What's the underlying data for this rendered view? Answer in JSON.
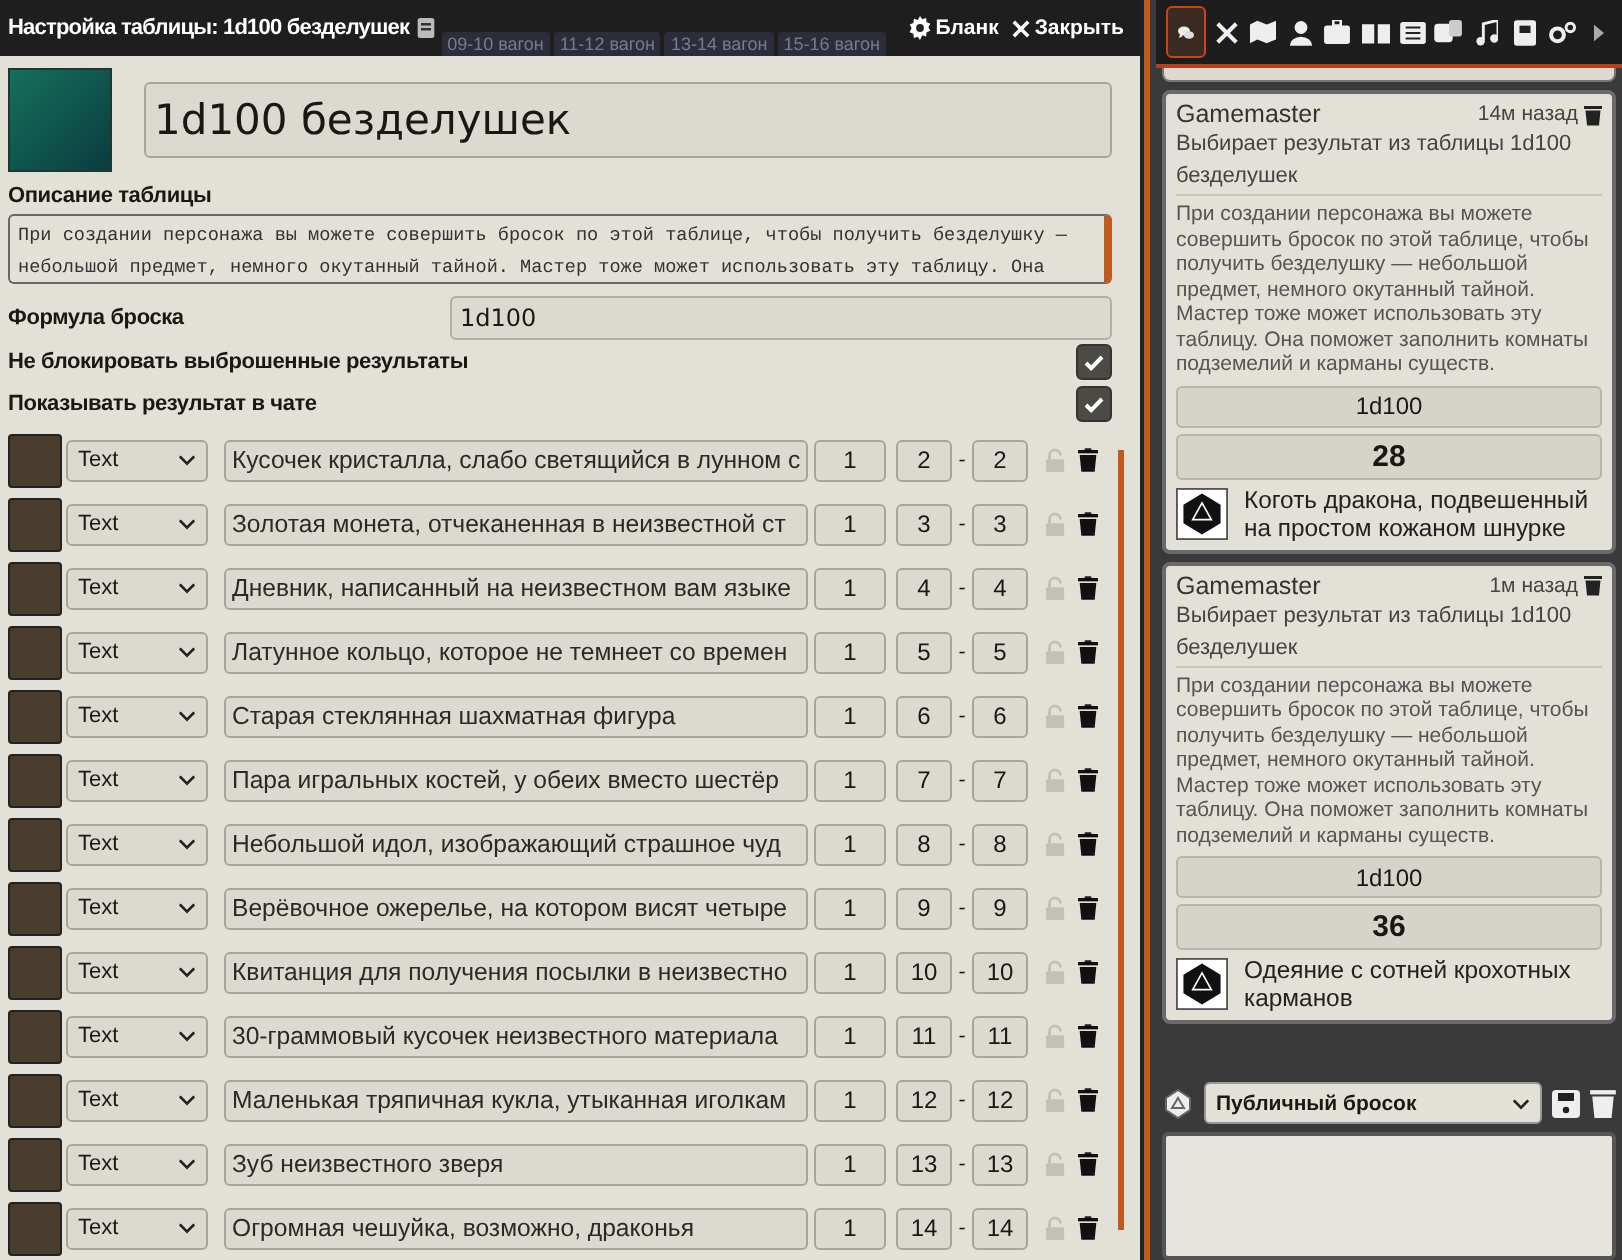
{
  "window": {
    "title": "Настройка таблицы: 1d100 безделушек",
    "buttons": [
      {
        "kind": "settings",
        "label": "Бланк"
      },
      {
        "kind": "close",
        "label": "Закрыть"
      }
    ]
  },
  "scene_tabs": [
    "09-10 вагон",
    "11-12 вагон",
    "13-14 вагон",
    "15-16 вагон"
  ],
  "table": {
    "name": "1d100 безделушек",
    "description_label": "Описание таблицы",
    "description": "При создании персонажа вы можете совершить бросок по этой таблице, чтобы получить безделушку — небольшой предмет, немного окутанный тайной. Мастер тоже может использовать эту таблицу. Она",
    "formula_label": "Формула броска",
    "formula": "1d100",
    "options": [
      {
        "label": "Не блокировать выброшенные результаты",
        "checked": true
      },
      {
        "label": "Показывать результат в чате",
        "checked": true
      }
    ],
    "results": [
      {
        "type": "Text",
        "text": "Кусочек кристалла, слабо светящийся в лунном с",
        "weight": "1",
        "range_low": "2",
        "dash": "-",
        "range_high": "2",
        "locked": false
      },
      {
        "type": "Text",
        "text": "Золотая монета, отчеканенная в неизвестной ст",
        "weight": "1",
        "range_low": "3",
        "dash": "-",
        "range_high": "3",
        "locked": false
      },
      {
        "type": "Text",
        "text": "Дневник, написанный на неизвестном вам языке",
        "weight": "1",
        "range_low": "4",
        "dash": "-",
        "range_high": "4",
        "locked": false
      },
      {
        "type": "Text",
        "text": "Латунное кольцо, которое не темнеет со времен",
        "weight": "1",
        "range_low": "5",
        "dash": "-",
        "range_high": "5",
        "locked": false
      },
      {
        "type": "Text",
        "text": "Старая стеклянная шахматная фигура",
        "weight": "1",
        "range_low": "6",
        "dash": "-",
        "range_high": "6",
        "locked": false
      },
      {
        "type": "Text",
        "text": "Пара игральных костей, у обеих вместо шестёр",
        "weight": "1",
        "range_low": "7",
        "dash": "-",
        "range_high": "7",
        "locked": false
      },
      {
        "type": "Text",
        "text": "Небольшой идол, изображающий страшное чуд",
        "weight": "1",
        "range_low": "8",
        "dash": "-",
        "range_high": "8",
        "locked": false
      },
      {
        "type": "Text",
        "text": "Верёвочное ожерелье, на котором висят четыре",
        "weight": "1",
        "range_low": "9",
        "dash": "-",
        "range_high": "9",
        "locked": false
      },
      {
        "type": "Text",
        "text": "Квитанция для получения посылки в неизвестно",
        "weight": "1",
        "range_low": "10",
        "dash": "-",
        "range_high": "10",
        "locked": false
      },
      {
        "type": "Text",
        "text": "30-граммовый кусочек неизвестного материала",
        "weight": "1",
        "range_low": "11",
        "dash": "-",
        "range_high": "11",
        "locked": false
      },
      {
        "type": "Text",
        "text": "Маленькая тряпичная кукла, утыканная иголкам",
        "weight": "1",
        "range_low": "12",
        "dash": "-",
        "range_high": "12",
        "locked": false
      },
      {
        "type": "Text",
        "text": "Зуб неизвестного зверя",
        "weight": "1",
        "range_low": "13",
        "dash": "-",
        "range_high": "13",
        "locked": false
      },
      {
        "type": "Text",
        "text": "Огромная чешуйка, возможно, драконья",
        "weight": "1",
        "range_low": "14",
        "dash": "-",
        "range_high": "14",
        "locked": false
      }
    ]
  },
  "sidebar": {
    "tabs": [
      {
        "kind": "chat",
        "selected": true
      },
      {
        "kind": "combat",
        "selected": false
      },
      {
        "kind": "scenes",
        "selected": false
      },
      {
        "kind": "actors",
        "selected": false
      },
      {
        "kind": "items",
        "selected": false
      },
      {
        "kind": "journal",
        "selected": false
      },
      {
        "kind": "tables",
        "selected": false
      },
      {
        "kind": "cards",
        "selected": false
      },
      {
        "kind": "playlists",
        "selected": false
      },
      {
        "kind": "compendium",
        "selected": false
      },
      {
        "kind": "settings",
        "selected": false
      },
      {
        "kind": "collapse",
        "selected": false
      }
    ],
    "messages": [
      {
        "author": "Gamemaster",
        "time": "14м назад",
        "flavor": "Выбирает результат из таблицы 1d100 безделушек",
        "description": "При создании персонажа вы можете совершить бросок по этой таблице, чтобы получить безделушку — небольшой предмет, немного окутанный тайной. Мастер тоже может использовать эту таблицу. Она поможет заполнить комнаты подземелий и карманы существ.",
        "formula": "1d100",
        "total": "28",
        "result": "Коготь дракона, подвешенный на простом кожаном шнурке"
      },
      {
        "author": "Gamemaster",
        "time": "1м назад",
        "flavor": "Выбирает результат из таблицы 1d100 безделушек",
        "description": "При создании персонажа вы можете совершить бросок по этой таблице, чтобы получить безделушку — небольшой предмет, немного окутанный тайной. Мастер тоже может использовать эту таблицу. Она поможет заполнить комнаты подземелий и карманы существ.",
        "formula": "1d100",
        "total": "36",
        "result": "Одеяние с сотней крохотных карманов"
      }
    ],
    "roll_mode": "Публичный бросок"
  }
}
